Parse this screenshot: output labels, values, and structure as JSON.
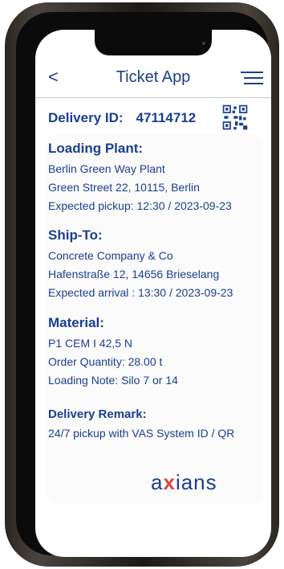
{
  "header": {
    "back": "<",
    "title": "Ticket App"
  },
  "delivery": {
    "label": "Delivery ID:",
    "id": "47114712"
  },
  "loading_plant": {
    "heading": "Loading Plant:",
    "name": "Berlin Green Way Plant",
    "address": "Green Street 22, 10115, Berlin",
    "pickup": "Expected pickup: 12:30 / 2023-09-23"
  },
  "ship_to": {
    "heading": "Ship-To:",
    "name": "Concrete Company & Co",
    "address": "Hafenstraße 12, 14656 Brieselang",
    "arrival": "Expected arrival : 13:30 / 2023-09-23"
  },
  "material": {
    "heading": "Material:",
    "type": "P1 CEM I 42,5 N",
    "quantity": "Order Quantity:  28.00 t",
    "note": "Loading Note: Silo 7 or 14"
  },
  "remark": {
    "heading": "Delivery Remark:",
    "text": "24/7 pickup with VAS System ID / QR"
  },
  "logo": {
    "a": "a",
    "x": "x",
    "rest": "ians"
  },
  "colors": {
    "primary": "#1b3f8f",
    "logo_x": "#e0453c"
  }
}
